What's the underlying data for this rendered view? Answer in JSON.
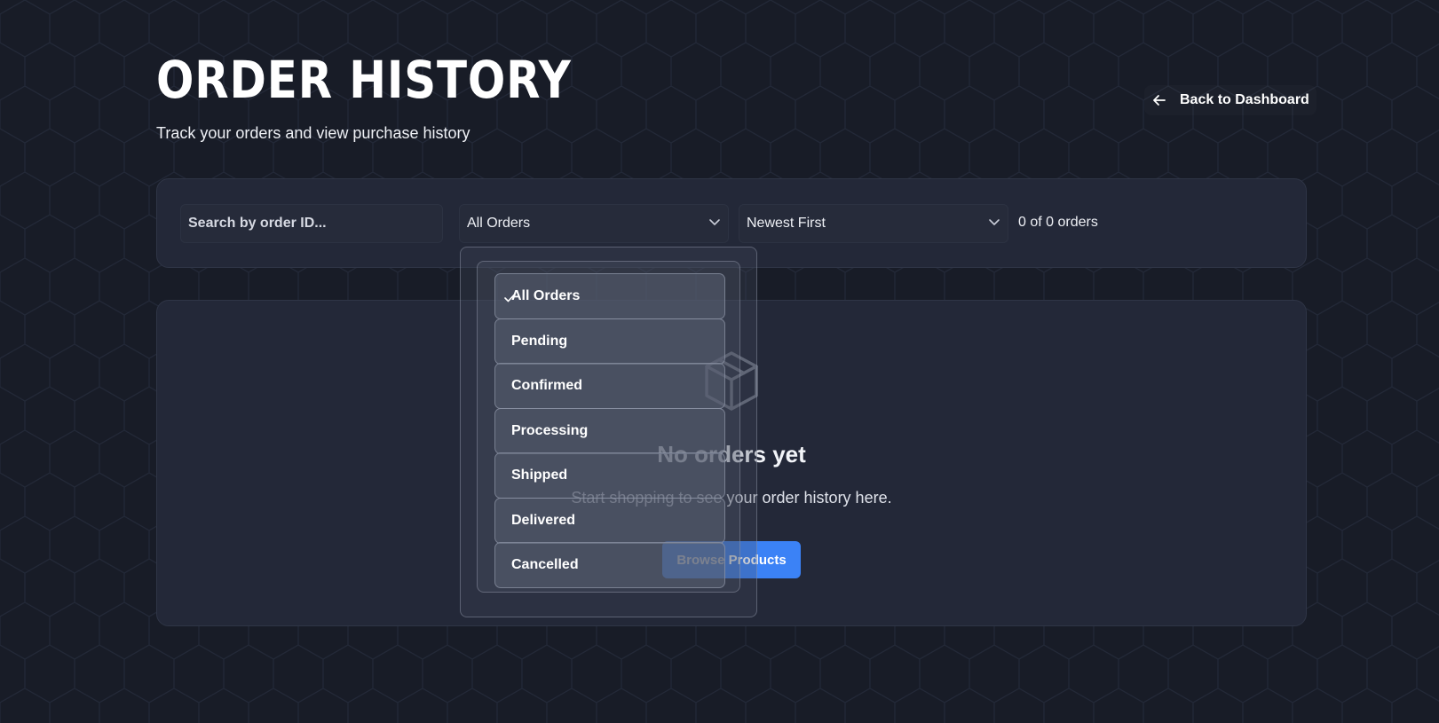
{
  "header": {
    "title": "ORDER HISTORY",
    "subtitle": "Track your orders and view purchase history",
    "back_label": "Back to Dashboard"
  },
  "filters": {
    "search_placeholder": "Search by order ID...",
    "status_selected": "All Orders",
    "sort_selected": "Newest First",
    "count_text": "0 of 0 orders"
  },
  "status_dropdown": {
    "open": true,
    "selected_index": 0,
    "options": [
      "All Orders",
      "Pending",
      "Confirmed",
      "Processing",
      "Shipped",
      "Delivered",
      "Cancelled"
    ]
  },
  "empty_state": {
    "title": "No orders yet",
    "message": "Start shopping to see your order history here.",
    "button_label": "Browse Products"
  },
  "colors": {
    "background": "#181c27",
    "card": "#232838",
    "accent": "#3b82f6"
  },
  "icons": {
    "back": "arrow-left-icon",
    "chevron": "chevron-down-icon",
    "empty": "package-icon",
    "selected": "check-icon"
  }
}
